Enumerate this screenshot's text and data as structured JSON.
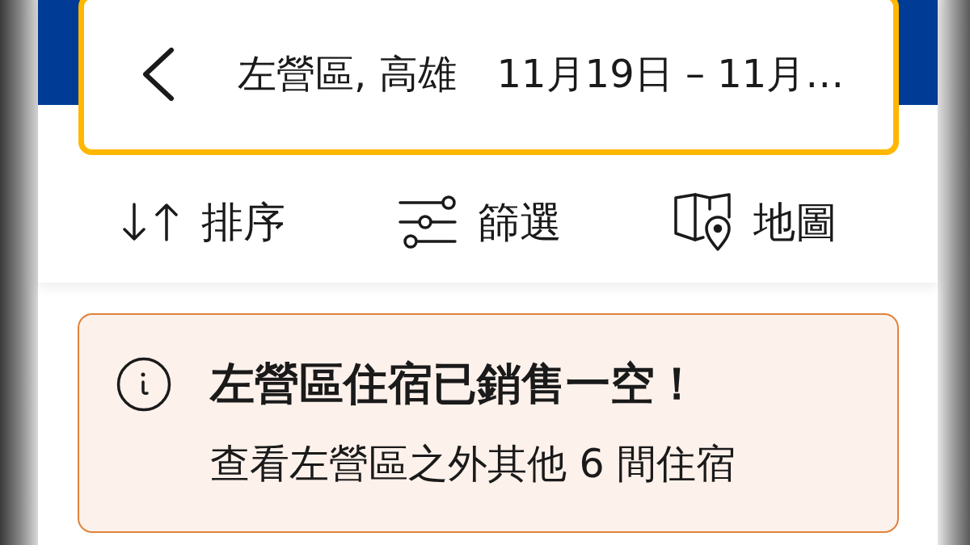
{
  "search_bar": {
    "location": "左營區, 高雄",
    "dates": "11月19日 – 11月…"
  },
  "toolbar": [
    {
      "kind": "sort",
      "label": "排序"
    },
    {
      "kind": "filter",
      "label": "篩選"
    },
    {
      "kind": "map",
      "label": "地圖"
    }
  ],
  "alert": {
    "title": "左營區住宿已銷售一空！",
    "message": "查看左營區之外其他 6 間住宿"
  }
}
